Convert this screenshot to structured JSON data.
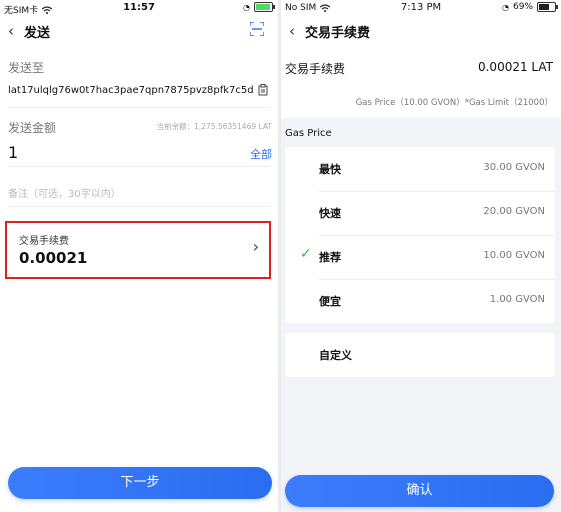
{
  "left": {
    "status": {
      "carrier": "无SIM卡",
      "time": "11:57"
    },
    "nav": {
      "title": "发送"
    },
    "send_to_label": "发送至",
    "address": "lat17ulqlg76w0t7hac3pae7qpn7875pvz8pfk7c5d",
    "amount_label": "发送金额",
    "balance": "当前余额：1,275.56351469 LAT",
    "amount_value": "1",
    "all_label": "全部",
    "note_placeholder": "备注（可选，30字以内）",
    "fee_label": "交易手续费",
    "fee_value": "0.00021",
    "next_button": "下一步"
  },
  "right": {
    "status": {
      "carrier": "No SIM",
      "time": "7:13 PM",
      "battery": "69%"
    },
    "nav": {
      "title": "交易手续费"
    },
    "fee_label": "交易手续费",
    "fee_value": "0.00021 LAT",
    "formula": "Gas Price（10.00 GVON）*Gas Limit（21000）",
    "gas_price_heading": "Gas Price",
    "options": [
      {
        "name": "最快",
        "value": "30.00 GVON",
        "selected": false
      },
      {
        "name": "快速",
        "value": "20.00 GVON",
        "selected": false
      },
      {
        "name": "推荐",
        "value": "10.00 GVON",
        "selected": true
      },
      {
        "name": "便宜",
        "value": "1.00 GVON",
        "selected": false
      }
    ],
    "custom_label": "自定义",
    "confirm_button": "确认"
  },
  "colors": {
    "primary": "#2a6df0",
    "highlight_border": "#e02020",
    "check": "#3bb34a"
  },
  "icons": [
    "back-chevron-icon",
    "scan-icon",
    "paste-icon",
    "chevron-right-icon",
    "check-icon",
    "wifi-icon",
    "battery-icon"
  ]
}
